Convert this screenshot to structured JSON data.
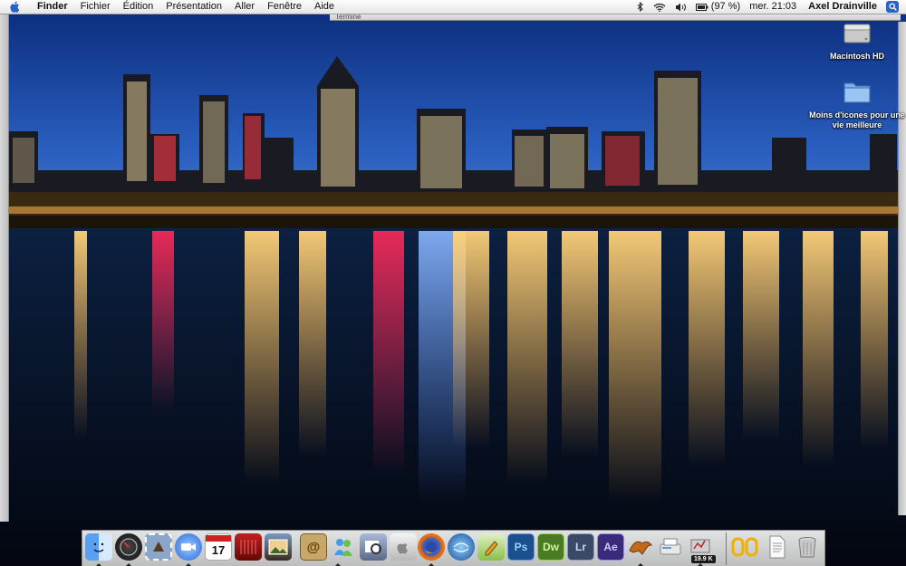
{
  "menubar": {
    "app_name": "Finder",
    "menus": [
      "Fichier",
      "Édition",
      "Présentation",
      "Aller",
      "Fenêtre",
      "Aide"
    ],
    "battery": "(97 %)",
    "clock": "mer. 21:03",
    "user": "Axel Drainville"
  },
  "window": {
    "title_fragment": "Terminé"
  },
  "desktop": {
    "icons": [
      {
        "label": "Macintosh HD",
        "icon": "hard-drive-icon"
      },
      {
        "label": "Moins d'icones pour une vie meilleure",
        "icon": "folder-icon"
      }
    ]
  },
  "dock": {
    "items": [
      {
        "name": "finder",
        "glyph": "",
        "color": "#4a8fe0"
      },
      {
        "name": "dashboard",
        "glyph": "",
        "color": "#222"
      },
      {
        "name": "mail-stamp",
        "glyph": "",
        "color": "#6f8fb8"
      },
      {
        "name": "ichat",
        "glyph": "",
        "color": "#3a7de0"
      },
      {
        "name": "ical",
        "glyph": "17",
        "color": "#f2f2f2"
      },
      {
        "name": "front-row",
        "glyph": "",
        "color": "#a01818"
      },
      {
        "name": "iphoto",
        "glyph": "",
        "color": "#6a5a3a"
      },
      {
        "name": "address-book",
        "glyph": "@",
        "color": "#b89a5a"
      },
      {
        "name": "messenger",
        "glyph": "",
        "color": "#4aa0e0"
      },
      {
        "name": "preview",
        "glyph": "",
        "color": "#7a8aa8"
      },
      {
        "name": "apple-store",
        "glyph": "",
        "color": "#d8d8d8"
      },
      {
        "name": "firefox",
        "glyph": "",
        "color": "#e06a10"
      },
      {
        "name": "google-earth",
        "glyph": "",
        "color": "#2a5ab0"
      },
      {
        "name": "editor",
        "glyph": "",
        "color": "#9ad04a"
      },
      {
        "name": "photoshop",
        "glyph": "Ps",
        "color": "#1a4f8f"
      },
      {
        "name": "dreamweaver",
        "glyph": "Dw",
        "color": "#5a8a2a"
      },
      {
        "name": "lightroom",
        "glyph": "Lr",
        "color": "#3f4f6a"
      },
      {
        "name": "after-effects",
        "glyph": "Ae",
        "color": "#4a3a8a"
      },
      {
        "name": "x-lion",
        "glyph": "",
        "color": "#b85a1a"
      },
      {
        "name": "printer",
        "glyph": "",
        "color": "#e8e8e8"
      },
      {
        "name": "activity-monitor",
        "glyph": "",
        "color": "#c8c8c8"
      },
      {
        "name": "stuffit",
        "glyph": "",
        "color": "#f0b000"
      },
      {
        "name": "document",
        "glyph": "",
        "color": "#f5f5f5"
      },
      {
        "name": "trash",
        "glyph": "",
        "color": "#bbb"
      }
    ],
    "activity_badge": "19.9 K"
  },
  "colors": {
    "sky_top": "#0a2a7a",
    "sky_horizon": "#2a5fc0",
    "water": "#06122a"
  }
}
